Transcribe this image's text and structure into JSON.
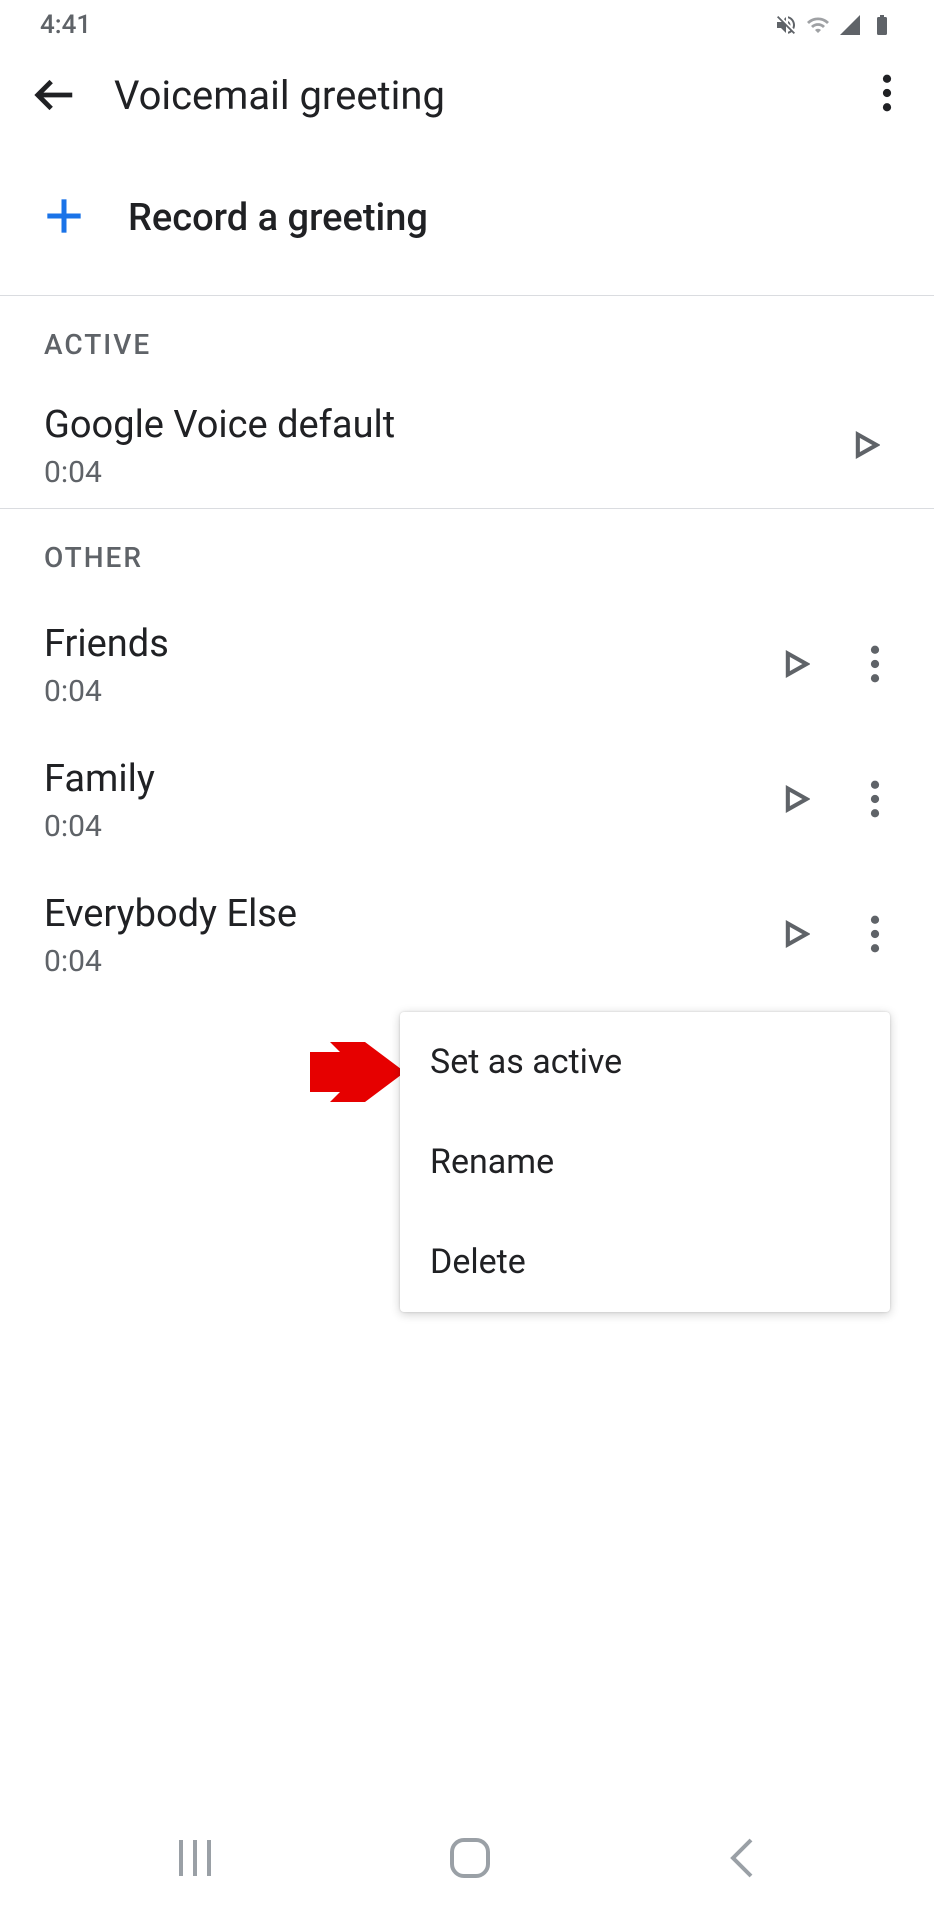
{
  "status": {
    "time": "4:41"
  },
  "header": {
    "title": "Voicemail greeting"
  },
  "record": {
    "label": "Record a greeting"
  },
  "sections": {
    "active_label": "ACTIVE",
    "other_label": "OTHER"
  },
  "active_item": {
    "title": "Google Voice default",
    "duration": "0:04"
  },
  "other_items": [
    {
      "title": "Friends",
      "duration": "0:04"
    },
    {
      "title": "Family",
      "duration": "0:04"
    },
    {
      "title": "Everybody Else",
      "duration": "0:04"
    }
  ],
  "menu": {
    "set_active": "Set as active",
    "rename": "Rename",
    "delete": "Delete"
  }
}
